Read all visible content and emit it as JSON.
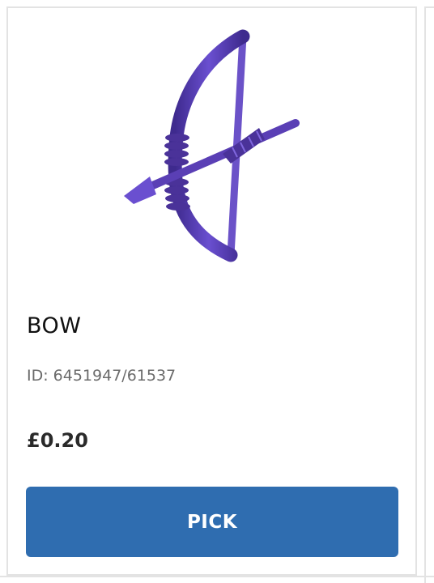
{
  "product": {
    "title": "BOW",
    "id_text": "ID: 6451947/61537",
    "price": "£0.20",
    "image_icon": "bow-and-arrow-icon",
    "image_color": "#5a3fb5"
  },
  "actions": {
    "pick_label": "PICK",
    "button_color": "#2f6db0"
  }
}
